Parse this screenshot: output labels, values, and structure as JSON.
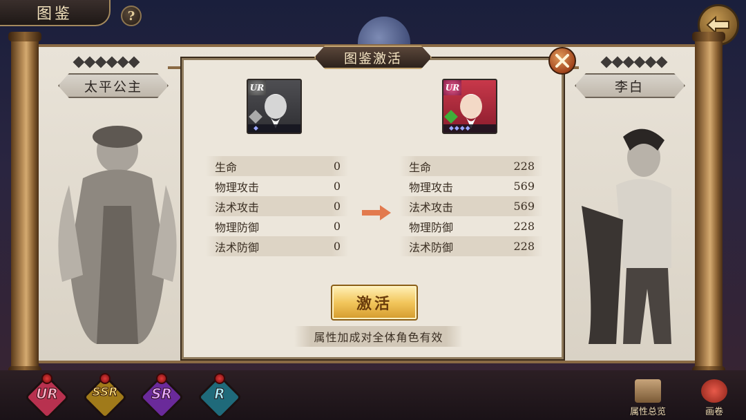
{
  "header": {
    "title": "图鉴",
    "help_label": "?"
  },
  "left_character": {
    "name": "太平公主",
    "star_count": 6
  },
  "right_character": {
    "name": "李白",
    "star_count": 6
  },
  "dialog": {
    "title": "图鉴激活",
    "before": {
      "rank": "UR",
      "stats": [
        {
          "label": "生命",
          "value": "0"
        },
        {
          "label": "物理攻击",
          "value": "0"
        },
        {
          "label": "法术攻击",
          "value": "0"
        },
        {
          "label": "物理防御",
          "value": "0"
        },
        {
          "label": "法术防御",
          "value": "0"
        }
      ]
    },
    "after": {
      "rank": "UR",
      "stats": [
        {
          "label": "生命",
          "value": "228"
        },
        {
          "label": "物理攻击",
          "value": "569"
        },
        {
          "label": "法术攻击",
          "value": "569"
        },
        {
          "label": "物理防御",
          "value": "228"
        },
        {
          "label": "法术防御",
          "value": "228"
        }
      ]
    },
    "activate_label": "激活",
    "note": "属性加成对全体角色有效"
  },
  "bottom": {
    "rarity_tabs": [
      "UR",
      "SSR",
      "SR",
      "R"
    ],
    "attr_overview_label": "属性总览",
    "scroll_label": "画卷"
  },
  "colors": {
    "accent_gold": "#f2c65c",
    "dialog_bg": "#ece6db",
    "arrow": "#e27a4e"
  }
}
